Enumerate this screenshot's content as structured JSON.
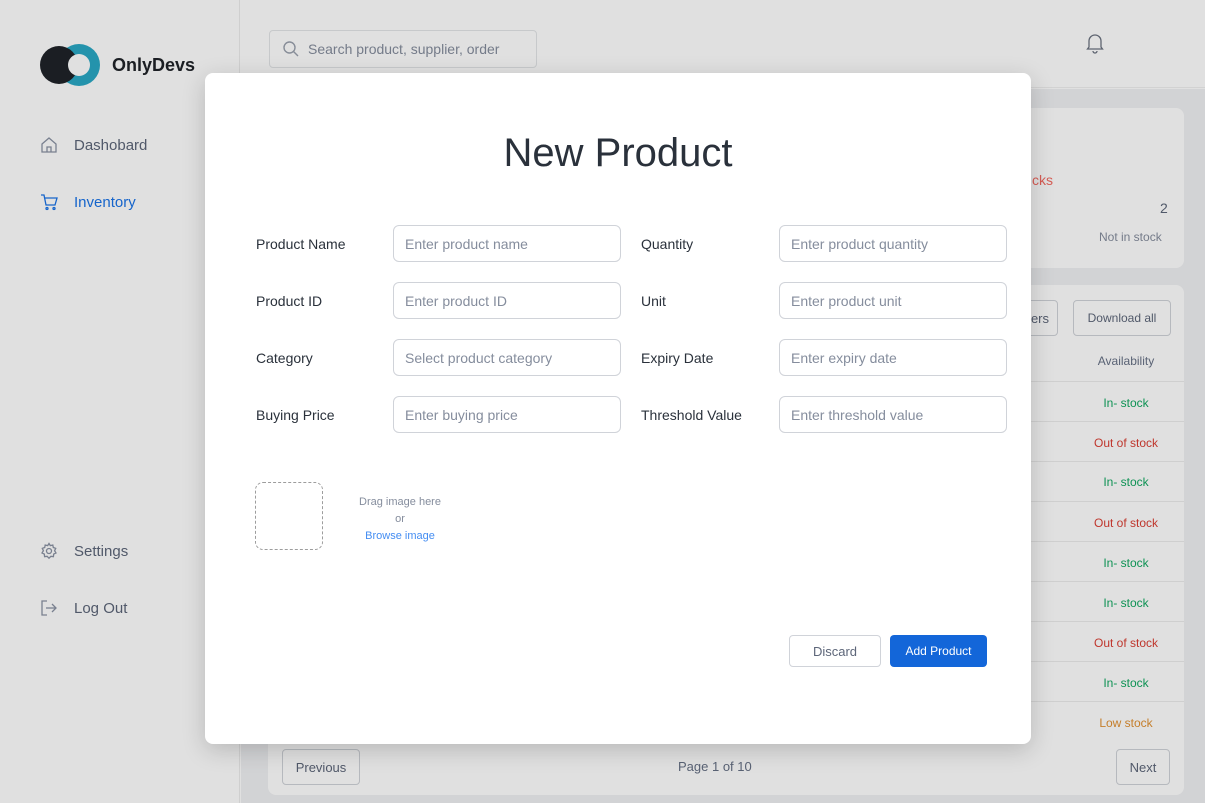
{
  "app": {
    "name": "OnlyDevs"
  },
  "sidebar": {
    "items": [
      {
        "label": "Dashobard",
        "icon": "home-icon"
      },
      {
        "label": "Inventory",
        "icon": "cart-icon",
        "active": true
      }
    ],
    "bottom_items": [
      {
        "label": "Settings",
        "icon": "gear-icon"
      },
      {
        "label": "Log Out",
        "icon": "logout-icon"
      }
    ]
  },
  "search": {
    "placeholder": "Search product, supplier, order"
  },
  "background": {
    "stocks_fragment": "cks",
    "stat_value": "2",
    "stat_label": "Not in stock",
    "filters_fragment": "ers",
    "download_label": "Download all",
    "availability_header": "Availability",
    "availability": [
      "In- stock",
      "Out of stock",
      "In- stock",
      "Out of stock",
      "In- stock",
      "In- stock",
      "Out of stock",
      "In- stock",
      "Low stock"
    ],
    "pagination": {
      "previous": "Previous",
      "page_text": "Page 1 of 10",
      "next": "Next"
    }
  },
  "modal": {
    "title": "New Product",
    "fields": {
      "product_name": {
        "label": "Product Name",
        "placeholder": "Enter product name"
      },
      "product_id": {
        "label": "Product ID",
        "placeholder": "Enter product ID"
      },
      "category": {
        "label": "Category",
        "placeholder": "Select product category"
      },
      "buying_price": {
        "label": "Buying Price",
        "placeholder": "Enter buying price"
      },
      "quantity": {
        "label": "Quantity",
        "placeholder": "Enter product quantity"
      },
      "unit": {
        "label": "Unit",
        "placeholder": "Enter product unit"
      },
      "expiry_date": {
        "label": "Expiry Date",
        "placeholder": "Enter expiry date"
      },
      "threshold_value": {
        "label": "Threshold Value",
        "placeholder": "Enter threshold value"
      }
    },
    "image_upload": {
      "drag_text": "Drag image here",
      "or_text": "or",
      "browse_text": "Browse image"
    },
    "buttons": {
      "discard": "Discard",
      "add": "Add Product"
    }
  },
  "colors": {
    "accent": "#1366D9",
    "in_stock": "#10A760",
    "out_of_stock": "#DA3E33",
    "low_stock": "#E19133"
  }
}
